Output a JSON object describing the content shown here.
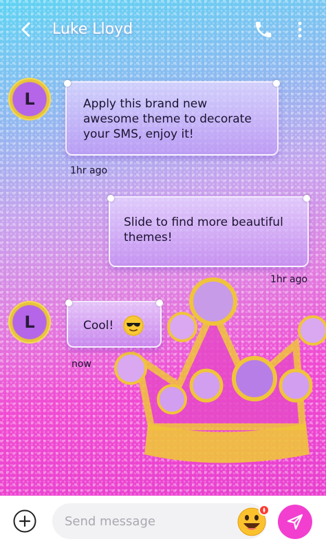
{
  "header": {
    "contact_name": "Luke Lloyd",
    "back_icon": "chevron-left-icon",
    "call_icon": "phone-icon",
    "menu_icon": "more-vertical-icon"
  },
  "messages": [
    {
      "direction": "incoming",
      "avatar_letter": "L",
      "text": "Apply this brand new awesome theme to decorate your SMS, enjoy it!",
      "time": "1hr ago"
    },
    {
      "direction": "outgoing",
      "text": "Slide to find more beautiful themes!",
      "time": "1hr ago"
    },
    {
      "direction": "incoming",
      "avatar_letter": "L",
      "text": "Cool!",
      "emoji": "sunglasses-emoji",
      "time": "now"
    }
  ],
  "composer": {
    "placeholder": "Send message",
    "add_icon": "plus-circle-icon",
    "emoji_icon": "grinning-emoji-icon",
    "send_icon": "send-icon"
  },
  "colors": {
    "send_button": "#f23fd0",
    "bubble": "#c9a6f5",
    "avatar_ring": "#e8c43a"
  }
}
